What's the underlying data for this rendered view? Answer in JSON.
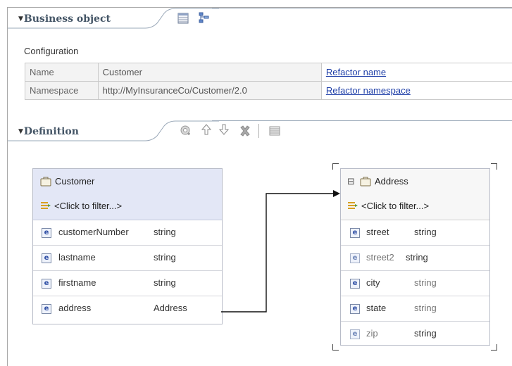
{
  "business_object": {
    "section_title": "Business object",
    "configuration_label": "Configuration",
    "toolbar_icons": [
      "table-view-icon",
      "tree-view-icon"
    ],
    "rows": [
      {
        "label": "Name",
        "value": "Customer",
        "action": "Refactor name"
      },
      {
        "label": "Namespace",
        "value": "http://MyInsuranceCo/Customer/2.0",
        "action": "Refactor namespace"
      }
    ]
  },
  "definition": {
    "section_title": "Definition",
    "toolbar_icons": [
      "add-field-icon",
      "move-up-icon",
      "move-down-icon",
      "delete-icon",
      "properties-icon"
    ]
  },
  "customer_bo": {
    "title": "Customer",
    "filter": "<Click to filter...>",
    "fields": [
      {
        "name": "customerNumber",
        "type": "string"
      },
      {
        "name": "lastname",
        "type": "string"
      },
      {
        "name": "firstname",
        "type": "string"
      },
      {
        "name": "address",
        "type": "Address"
      }
    ]
  },
  "address_bo": {
    "collapse_glyph": "⊟",
    "title": "Address",
    "filter": "<Click to filter...>",
    "fields": [
      {
        "name": "street",
        "type": "string"
      },
      {
        "name": "street2",
        "type": "string"
      },
      {
        "name": "city",
        "type": "string"
      },
      {
        "name": "state",
        "type": "string"
      },
      {
        "name": "zip",
        "type": "string"
      }
    ]
  },
  "colors": {
    "header_bg": "#e3e7f6",
    "link": "#1f3fa8",
    "section_title": "#445566"
  }
}
